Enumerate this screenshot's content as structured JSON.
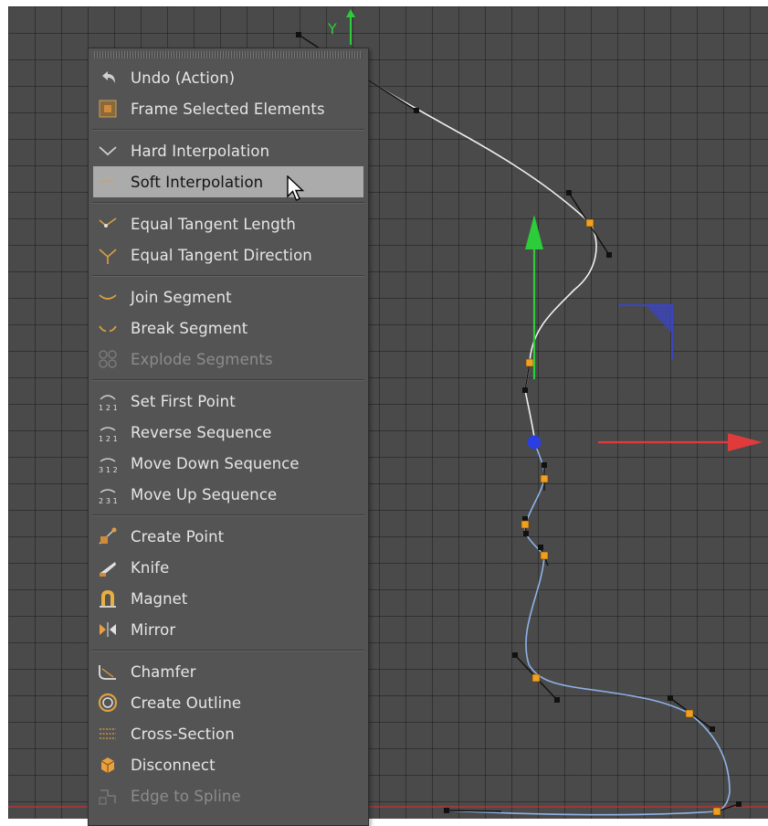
{
  "viewport": {
    "axis_label_y": "Y",
    "colors": {
      "grid_bg": "#4a4a4a",
      "spline_white": "#f2f2f2",
      "spline_blue": "#8fb2e8",
      "point_orange": "#f0a020",
      "tangent_black": "#111111",
      "axis_green": "#2ccc3a",
      "axis_red": "#e03a3a",
      "axis_blue": "#3b45c4"
    }
  },
  "context_menu": {
    "groups": [
      [
        {
          "label": "Undo (Action)",
          "icon": "undo-icon",
          "disabled": false
        },
        {
          "label": "Frame Selected Elements",
          "icon": "frame-selected-icon",
          "disabled": false
        }
      ],
      [
        {
          "label": "Hard Interpolation",
          "icon": "hard-interpolation-icon",
          "disabled": false
        },
        {
          "label": "Soft Interpolation",
          "icon": "soft-interpolation-icon",
          "disabled": false,
          "highlighted": true
        }
      ],
      [
        {
          "label": "Equal Tangent Length",
          "icon": "equal-tangent-length-icon",
          "disabled": false
        },
        {
          "label": "Equal Tangent Direction",
          "icon": "equal-tangent-direction-icon",
          "disabled": false
        }
      ],
      [
        {
          "label": "Join Segment",
          "icon": "join-segment-icon",
          "disabled": false
        },
        {
          "label": "Break Segment",
          "icon": "break-segment-icon",
          "disabled": false
        },
        {
          "label": "Explode Segments",
          "icon": "explode-segments-icon",
          "disabled": true
        }
      ],
      [
        {
          "label": "Set First Point",
          "icon": "set-first-point-icon",
          "disabled": false
        },
        {
          "label": "Reverse Sequence",
          "icon": "reverse-sequence-icon",
          "disabled": false
        },
        {
          "label": "Move Down Sequence",
          "icon": "move-down-sequence-icon",
          "disabled": false
        },
        {
          "label": "Move Up Sequence",
          "icon": "move-up-sequence-icon",
          "disabled": false
        }
      ],
      [
        {
          "label": "Create Point",
          "icon": "create-point-icon",
          "disabled": false
        },
        {
          "label": "Knife",
          "icon": "knife-icon",
          "disabled": false
        },
        {
          "label": "Magnet",
          "icon": "magnet-icon",
          "disabled": false
        },
        {
          "label": "Mirror",
          "icon": "mirror-icon",
          "disabled": false
        }
      ],
      [
        {
          "label": "Chamfer",
          "icon": "chamfer-icon",
          "disabled": false
        },
        {
          "label": "Create Outline",
          "icon": "create-outline-icon",
          "disabled": false
        },
        {
          "label": "Cross-Section",
          "icon": "cross-section-icon",
          "disabled": false
        },
        {
          "label": "Disconnect",
          "icon": "disconnect-icon",
          "disabled": false
        },
        {
          "label": "Edge to Spline",
          "icon": "edge-to-spline-icon",
          "disabled": true
        }
      ]
    ],
    "colors": {
      "bg": "#545454",
      "highlight_bg": "#ababab",
      "text": "#e6e6e6",
      "text_disabled": "#8c8c8c"
    }
  },
  "cursor": {
    "icon": "mouse-pointer-icon"
  }
}
